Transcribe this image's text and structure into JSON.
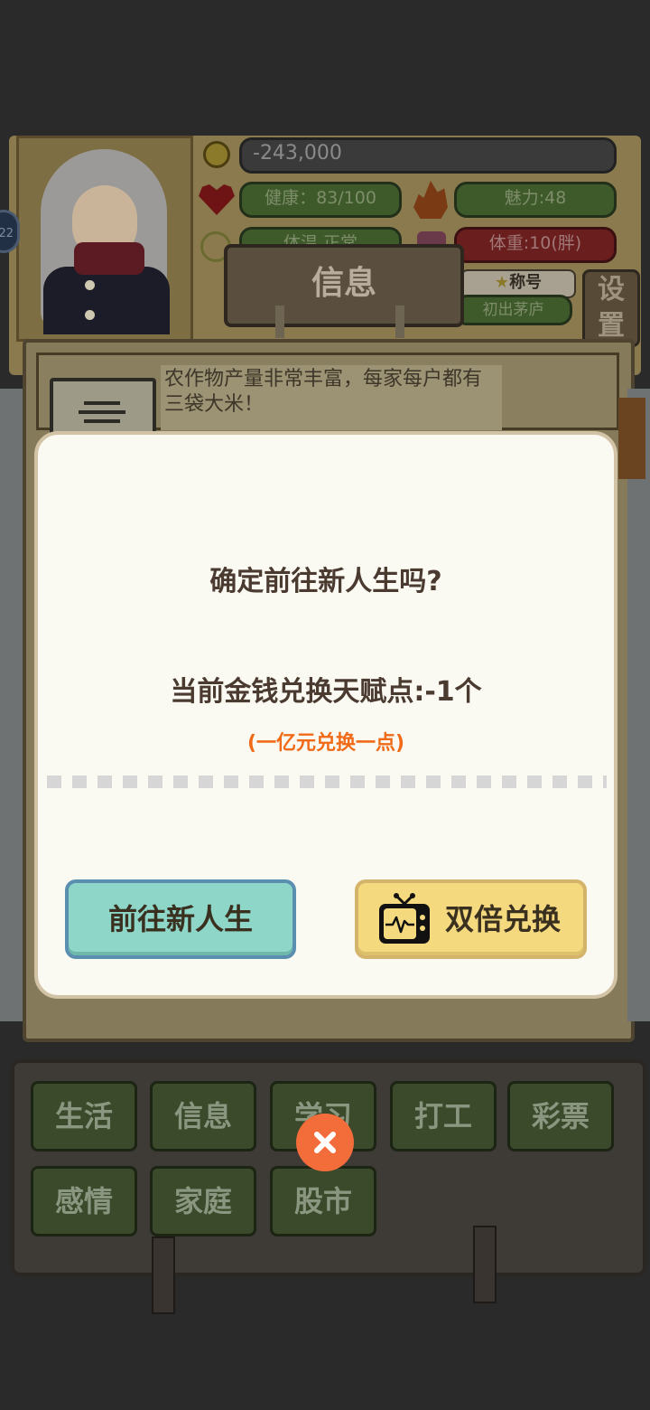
{
  "stats": {
    "money": "-243,000",
    "health": "健康：83/100",
    "charm": "魅力:48",
    "weight": "体重:10(胖)",
    "title_label": "称号",
    "title_value": "初出茅庐",
    "status_partial": "体温 正常"
  },
  "side_badge": "22",
  "tab_title": "信息",
  "settings_label": "设置",
  "news_text": "农作物产量非常丰富，每家每户都有三袋大米！",
  "dialog": {
    "question": "确定前往新人生吗?",
    "exchange": "当前金钱兑换天赋点:-1个",
    "note": "(一亿元兑换一点)",
    "primary_button": "前往新人生",
    "secondary_button": "双倍兑换"
  },
  "menu": [
    "生活",
    "信息",
    "学习",
    "打工",
    "彩票",
    "感情",
    "家庭",
    "股市"
  ],
  "colors": {
    "accent_orange": "#f06a18",
    "close_button": "#f26d3a",
    "primary_button": "#8dd6c8",
    "secondary_button": "#f4d97e"
  }
}
